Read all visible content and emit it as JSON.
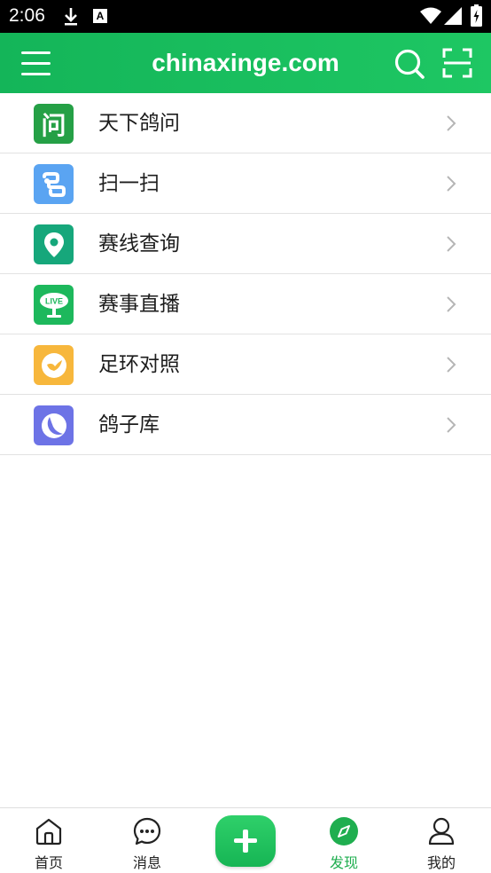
{
  "status_bar": {
    "time": "2:06",
    "icons": [
      "download-icon",
      "a-icon",
      "wifi-icon",
      "signal-icon",
      "battery-icon"
    ]
  },
  "header": {
    "title": "chinaxinge.com",
    "background": "#1ab85c"
  },
  "list": {
    "items": [
      {
        "label": "天下鸽问",
        "icon": "wen-icon",
        "icon_color": "#25a046",
        "icon_text": "问"
      },
      {
        "label": "扫一扫",
        "icon": "scan-icon",
        "icon_color": "#5aa4f2",
        "icon_text": ""
      },
      {
        "label": "赛线查询",
        "icon": "location-pin-icon",
        "icon_color": "#16a77b",
        "icon_text": ""
      },
      {
        "label": "赛事直播",
        "icon": "live-trophy-icon",
        "icon_color": "#1db85c",
        "icon_text": "LIVE"
      },
      {
        "label": "足环对照",
        "icon": "ring-compare-icon",
        "icon_color": "#f7b73c",
        "icon_text": ""
      },
      {
        "label": "鸽子库",
        "icon": "pigeon-library-icon",
        "icon_color": "#6d73e6",
        "icon_text": ""
      }
    ]
  },
  "bottom_nav": {
    "items": [
      {
        "label": "首页",
        "icon": "home-icon"
      },
      {
        "label": "消息",
        "icon": "message-icon"
      },
      {
        "label": "发现",
        "icon": "compass-icon",
        "active": true
      },
      {
        "label": "我的",
        "icon": "user-icon"
      }
    ],
    "active_color": "#1fae4f"
  }
}
